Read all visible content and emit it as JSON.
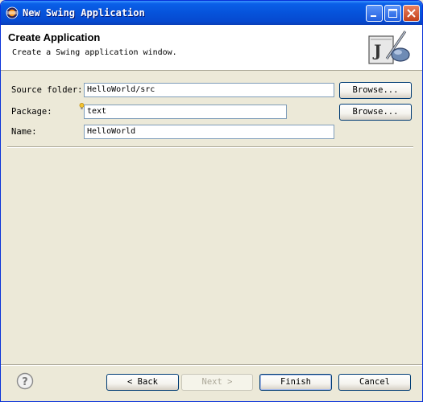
{
  "window": {
    "title": "New Swing Application",
    "icon": "eclipse-icon",
    "controls": {
      "minimize": "minimize-icon",
      "maximize": "maximize-icon",
      "close": "close-icon"
    }
  },
  "header": {
    "title": "Create Application",
    "description": "Create a Swing application window.",
    "icon": "java-wizard-icon"
  },
  "form": {
    "source_folder": {
      "label": "Source folder:",
      "value": "HelloWorld/src",
      "browse_label": "Browse..."
    },
    "package": {
      "label": "Package:",
      "value": "text",
      "browse_label": "Browse..."
    },
    "name": {
      "label": "Name:",
      "value": "HelloWorld"
    }
  },
  "footer": {
    "help_icon": "help-icon",
    "back_label": "< Back",
    "next_label": "Next >",
    "finish_label": "Finish",
    "cancel_label": "Cancel"
  },
  "colors": {
    "titlebar": "#0653DB",
    "dialog_bg": "#ECE9D8",
    "field_border": "#7F9DB9",
    "button_border": "#003C74"
  }
}
